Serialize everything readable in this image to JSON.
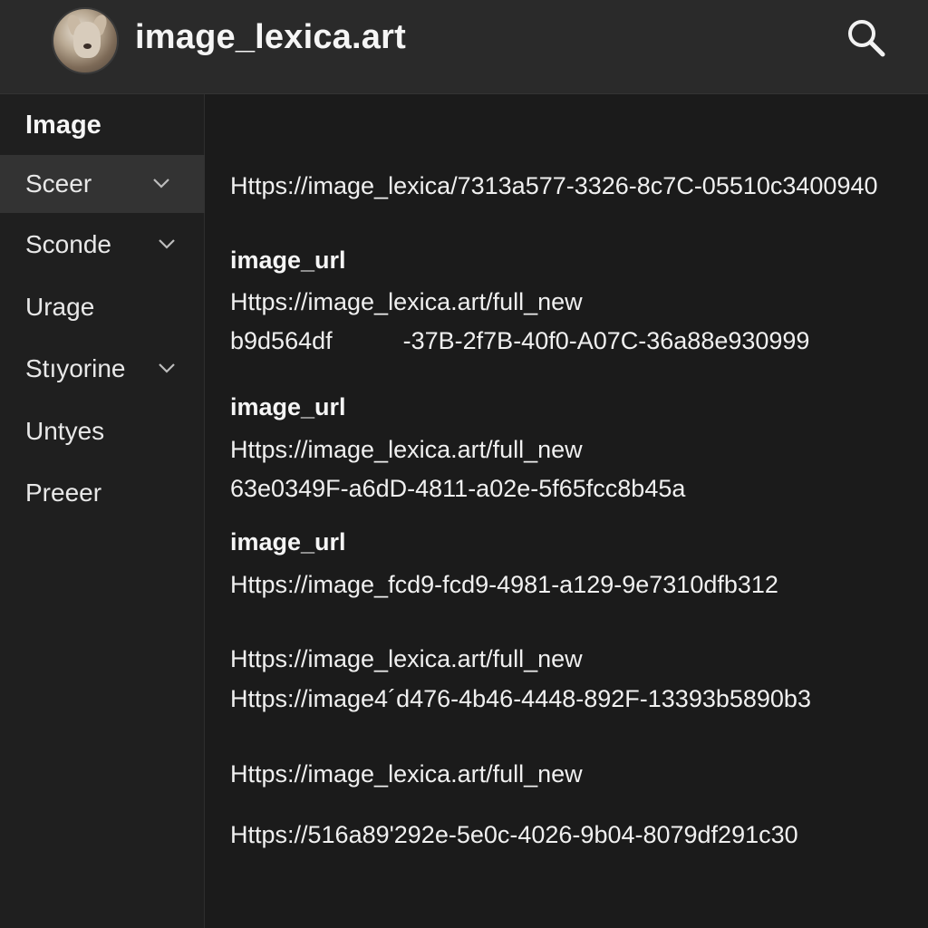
{
  "header": {
    "title": "image_lexica.art",
    "avatar_icon": "dog-avatar-icon",
    "search_icon": "search-icon"
  },
  "sidebar": {
    "heading": "Image",
    "items": [
      {
        "label": "Sceer",
        "has_chevron": true,
        "active": true
      },
      {
        "label": "Sconde",
        "has_chevron": true,
        "active": false
      },
      {
        "label": "Urage",
        "has_chevron": false,
        "active": false
      },
      {
        "label": "Stıyorine",
        "has_chevron": true,
        "active": false
      },
      {
        "label": "Untyes",
        "has_chevron": false,
        "active": false
      },
      {
        "label": "Preeer",
        "has_chevron": false,
        "active": false
      }
    ]
  },
  "main": {
    "entries": [
      {
        "text": "Https://image_lexica/7313a577-3326-8c7C-05510c3400940"
      },
      {
        "label": "image_url"
      },
      {
        "text": "Https://image_lexica.art/full_new"
      },
      {
        "text_a": "b9d564df",
        "text_b": "-37B-2f7B-40f0-A07C-36a88e930999"
      },
      {
        "label": "image_url"
      },
      {
        "text": "Https://image_lexica.art/full_new"
      },
      {
        "text": "63e0349F-a6dD-4811-a02e-5f65fcc8b45a"
      },
      {
        "label": "image_url"
      },
      {
        "text": "Https://image_fcd9-fcd9-4981-a129-9e7310dfb312"
      },
      {
        "text": "Https://image_lexica.art/full_new"
      },
      {
        "text": "Https://image4´d476-4b46-4448-892F-13393b5890b3"
      },
      {
        "text": "Https://image_lexica.art/full_new"
      },
      {
        "text": "Https://516a89'292e-5e0c-4026-9b04-8079df291c30"
      }
    ]
  },
  "colors": {
    "header_bg": "#2a2a2a",
    "sidebar_bg": "#1f1f1f",
    "active_item_bg": "#333333",
    "content_bg": "#1b1b1b",
    "text": "#f0f0f0"
  }
}
